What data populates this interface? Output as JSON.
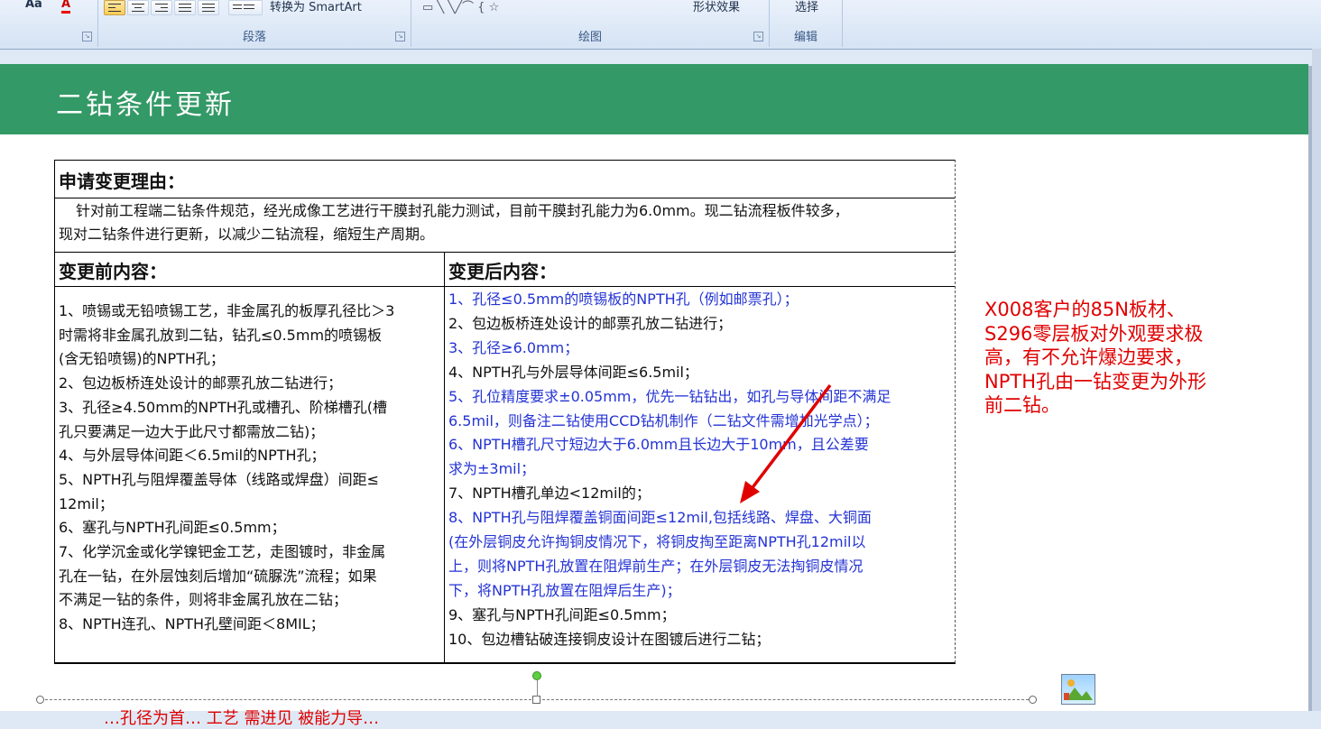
{
  "ribbon": {
    "font_size_label": "Aa",
    "font_color_label": "A",
    "smartart_label": "转换为 SmartArt",
    "shape_effects_label": "形状效果",
    "select_label": "选择",
    "groups": {
      "paragraph": "段落",
      "drawing": "绘图",
      "editing": "编辑"
    }
  },
  "slide": {
    "title": "二钻条件更新",
    "table": {
      "reason_header": "申请变更理由：",
      "reason_lines": [
        "针对前工程端二钻条件规范，经光成像工艺进行干膜封孔能力测试，目前干膜封孔能力为6.0mm。现二钻流程板件较多，",
        "现对二钻条件进行更新，以减少二钻流程，缩短生产周期。"
      ],
      "before_header": "变更前内容：",
      "after_header": "变更后内容：",
      "before_lines": [
        "1、喷锡或无铅喷锡工艺，非金属孔的板厚孔径比＞3",
        "时需将非金属孔放到二钻，钻孔≤0.5mm的喷锡板",
        "(含无铅喷锡)的NPTH孔；",
        "2、包边板桥连处设计的邮票孔放二钻进行；",
        "3、孔径≥4.50mm的NPTH孔或槽孔、阶梯槽孔(槽",
        "孔只要满足一边大于此尺寸都需放二钻)；",
        "4、与外层导体间距＜6.5mil的NPTH孔；",
        "5、NPTH孔与阻焊覆盖导体（线路或焊盘）间距≤",
        "12mil；",
        "6、塞孔与NPTH孔间距≤0.5mm；",
        "7、化学沉金或化学镍钯金工艺，走图镀时，非金属",
        "孔在一钻，在外层蚀刻后增加“硫脲洗”流程；如果",
        "不满足一钻的条件，则将非金属孔放在二钻；",
        "8、NPTH连孔、NPTH孔壁间距＜8MIL；"
      ],
      "after_lines": [
        {
          "text": "1、孔径≤0.5mm的喷锡板的NPTH孔（例如邮票孔）；",
          "color": "blue"
        },
        {
          "text": "2、包边板桥连处设计的邮票孔放二钻进行；",
          "color": "black"
        },
        {
          "text": "3、孔径≥6.0mm；",
          "color": "blue"
        },
        {
          "text": "4、NPTH孔与外层导体间距≤6.5mil；",
          "color": "black"
        },
        {
          "text": "5、孔位精度要求±0.05mm，优先一钻钻出，如孔与导体间距不满足",
          "color": "blue"
        },
        {
          "text": "6.5mil，则备注二钻使用CCD钻机制作（二钻文件需增加光学点）；",
          "color": "blue"
        },
        {
          "text": "6、NPTH槽孔尺寸短边大于6.0mm且长边大于10mm，且公差要",
          "color": "blue"
        },
        {
          "text": "求为±3mil；",
          "color": "blue"
        },
        {
          "text": "7、NPTH槽孔单边<12mil的；",
          "color": "black"
        },
        {
          "text": "8、NPTH孔与阻焊覆盖铜面间距≤12mil,包括线路、焊盘、大铜面",
          "color": "blue"
        },
        {
          "text": "(在外层铜皮允许掏铜皮情况下，将铜皮掏至距离NPTH孔12mil以",
          "color": "blue"
        },
        {
          "text": "上，则将NPTH孔放置在阻焊前生产；在外层铜皮无法掏铜皮情况",
          "color": "blue"
        },
        {
          "text": "下，将NPTH孔放置在阻焊后生产)；",
          "color": "blue"
        },
        {
          "text": "9、塞孔与NPTH孔间距≤0.5mm；",
          "color": "black"
        },
        {
          "text": "10、包边槽钻破连接铜皮设计在图镀后进行二钻；",
          "color": "black"
        }
      ]
    },
    "side_note_lines": [
      "X008客户的85N板材、",
      "S296零层板对外观要求极",
      "高，有不允许爆边要求，",
      "NPTH孔由一钻变更为外形",
      "前二钻。"
    ],
    "bottom_cut_text": "…孔径为首… 工艺 需进见 被能力导…"
  },
  "colors": {
    "banner": "#339966",
    "blue_text": "#2433d4",
    "red_text": "#e00000",
    "arrow": "#e00000"
  },
  "icons": [
    "picture-icon",
    "rotate-handle-icon",
    "dialog-launcher-icon",
    "arrow-annotation"
  ]
}
